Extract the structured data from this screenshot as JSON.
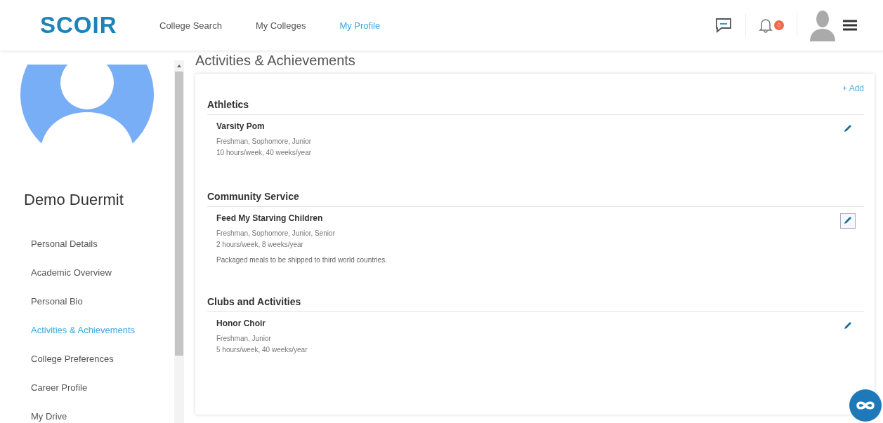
{
  "header": {
    "logo": "SCOIR",
    "nav": [
      {
        "label": "College Search",
        "selected": false
      },
      {
        "label": "My Colleges",
        "selected": false
      },
      {
        "label": "My Profile",
        "selected": true
      }
    ],
    "notification_badge": "0"
  },
  "sidebar": {
    "name": "Demo Duermit",
    "items": [
      {
        "label": "Personal Details",
        "selected": false
      },
      {
        "label": "Academic Overview",
        "selected": false
      },
      {
        "label": "Personal Bio",
        "selected": false
      },
      {
        "label": "Activities & Achievements",
        "selected": true
      },
      {
        "label": "College Preferences",
        "selected": false
      },
      {
        "label": "Career Profile",
        "selected": false
      },
      {
        "label": "My Drive",
        "selected": false
      }
    ]
  },
  "page_title": "Activities & Achievements",
  "add_label": "+ Add",
  "sections": [
    {
      "title": "Athletics",
      "activities": [
        {
          "name": "Varsity Pom",
          "years": "Freshman, Sophomore, Junior",
          "time": "10 hours/week, 40 weeks/year",
          "focused": false
        }
      ]
    },
    {
      "title": "Community Service",
      "activities": [
        {
          "name": "Feed My Starving Children",
          "years": "Freshman, Sophomore, Junior, Senior",
          "time": "2 hours/week, 8 weeks/year",
          "description": "Packaged meals to be shipped to third world countries.",
          "focused": true
        }
      ]
    },
    {
      "title": "Clubs and Activities",
      "activities": [
        {
          "name": "Honor Choir",
          "years": "Freshman, Junior",
          "time": "5 hours/week, 40 weeks/year",
          "focused": false
        }
      ]
    }
  ]
}
